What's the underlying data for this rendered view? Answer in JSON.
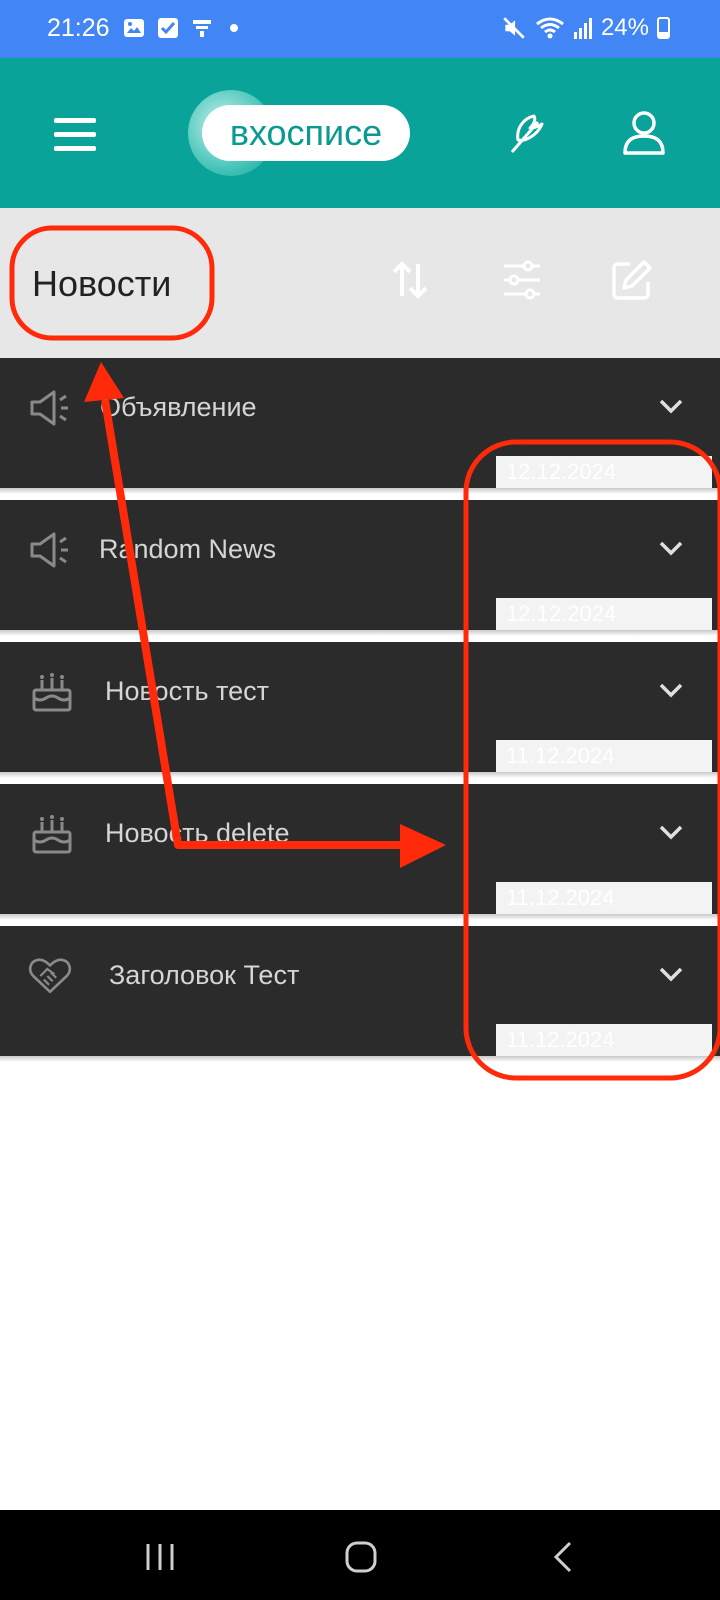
{
  "status_bar": {
    "time": "21:26",
    "battery": "24%",
    "icons": [
      "gallery-icon",
      "check-icon",
      "app-icon",
      "dot-icon",
      "mute-icon",
      "wifi-icon",
      "signal-icon",
      "battery-icon"
    ]
  },
  "app_bar": {
    "logo_text": "вхосписе",
    "color": "#0aa39a"
  },
  "header": {
    "title": "Новости"
  },
  "news": [
    {
      "title": "Объявление",
      "date": "12.12.2024",
      "icon": "megaphone-icon"
    },
    {
      "title": "Random News",
      "date": "12.12.2024",
      "icon": "megaphone-icon"
    },
    {
      "title": "Новость тест",
      "date": "11.12.2024",
      "icon": "cake-icon"
    },
    {
      "title": "Новость delete",
      "date": "11.12.2024",
      "icon": "cake-icon"
    },
    {
      "title": "Заголовок Тест",
      "date": "11.12.2024",
      "icon": "heart-handshake-icon"
    }
  ],
  "colors": {
    "status_bar": "#4285f4",
    "item_bg": "#2b2b2b",
    "annotation": "#ff2a0a"
  }
}
